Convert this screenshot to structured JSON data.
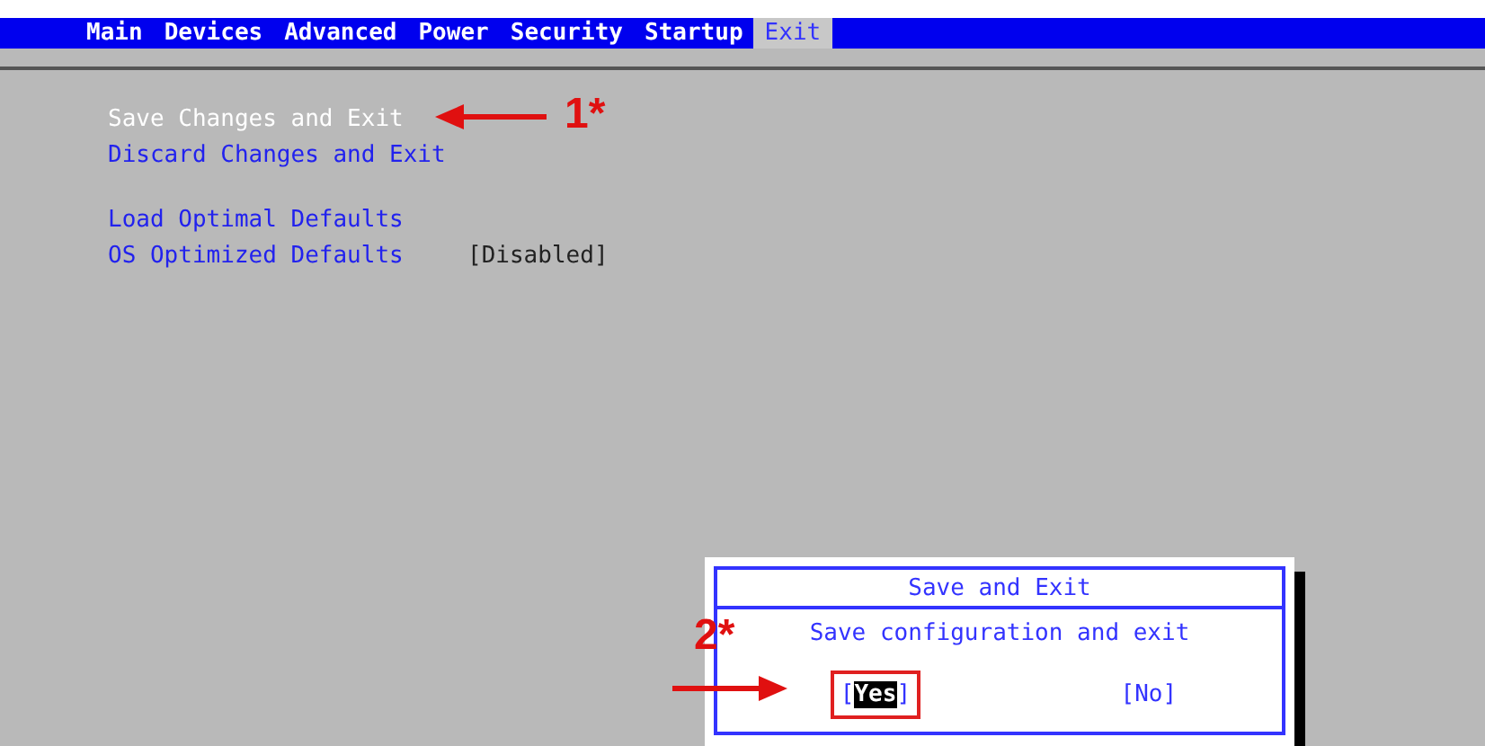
{
  "menu_tabs": [
    {
      "label": "Main",
      "selected": false
    },
    {
      "label": "Devices",
      "selected": false
    },
    {
      "label": "Advanced",
      "selected": false
    },
    {
      "label": "Power",
      "selected": false
    },
    {
      "label": "Security",
      "selected": false
    },
    {
      "label": "Startup",
      "selected": false
    },
    {
      "label": "Exit",
      "selected": true
    }
  ],
  "item_groups": [
    [
      {
        "label": "Save Changes and Exit",
        "selected": true
      },
      {
        "label": "Discard Changes and Exit",
        "selected": false
      }
    ],
    [
      {
        "label": "Load Optimal Defaults",
        "selected": false
      },
      {
        "label": "OS Optimized Defaults",
        "selected": false,
        "value": "[Disabled]"
      }
    ]
  ],
  "dialog": {
    "title": "Save and Exit",
    "message": "Save configuration and exit",
    "bracket_open": "[",
    "bracket_close": "]",
    "buttons": [
      {
        "label": "Yes",
        "selected": true,
        "annotated": true
      },
      {
        "label": "No",
        "selected": false,
        "annotated": false
      }
    ]
  },
  "annotations": [
    {
      "label": "1*"
    },
    {
      "label": "2*"
    }
  ]
}
